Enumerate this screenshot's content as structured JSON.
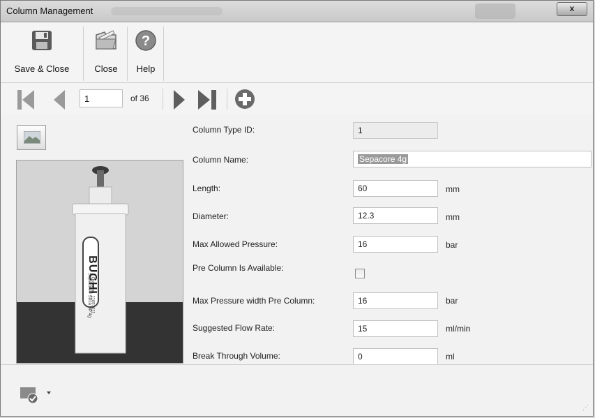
{
  "window": {
    "title": "Column Management",
    "close_glyph": "x"
  },
  "toolbar": {
    "save_close_label": "Save & Close",
    "close_label": "Close",
    "help_label": "Help"
  },
  "navigator": {
    "current_page": "1",
    "of_total": "of 36"
  },
  "fields": {
    "column_type_id": {
      "label": "Column Type ID:",
      "value": "1"
    },
    "column_name": {
      "label": "Column Name:",
      "value": "Sepacore 4g"
    },
    "length": {
      "label": "Length:",
      "value": "60",
      "unit": "mm"
    },
    "diameter": {
      "label": "Diameter:",
      "value": "12.3",
      "unit": "mm"
    },
    "max_pressure": {
      "label": "Max Allowed Pressure:",
      "value": "16",
      "unit": "bar"
    },
    "pre_column": {
      "label": "Pre Column Is Available:",
      "checked": false
    },
    "max_pressure_pre": {
      "label": "Max Pressure width Pre Column:",
      "value": "16",
      "unit": "bar"
    },
    "flow_rate": {
      "label": "Suggested Flow Rate:",
      "value": "15",
      "unit": "ml/min"
    },
    "break_volume": {
      "label": "Break Through Volume:",
      "value": "0",
      "unit": "ml"
    }
  },
  "photo": {
    "brand": "BUCHI",
    "order_text": "Order no. 11057611",
    "product_text": "Sepacore® Silica HP 4g"
  },
  "colors": {
    "window_bg": "#f2f2f2",
    "titlebar": "#d0d0d0",
    "selection": "#9a9a9a"
  },
  "icons": [
    "floppy-save-icon",
    "close-folder-icon",
    "help-question-icon",
    "first-record-icon",
    "previous-record-icon",
    "next-record-icon",
    "last-record-icon",
    "add-record-icon",
    "image-button-icon",
    "status-check-icon"
  ]
}
